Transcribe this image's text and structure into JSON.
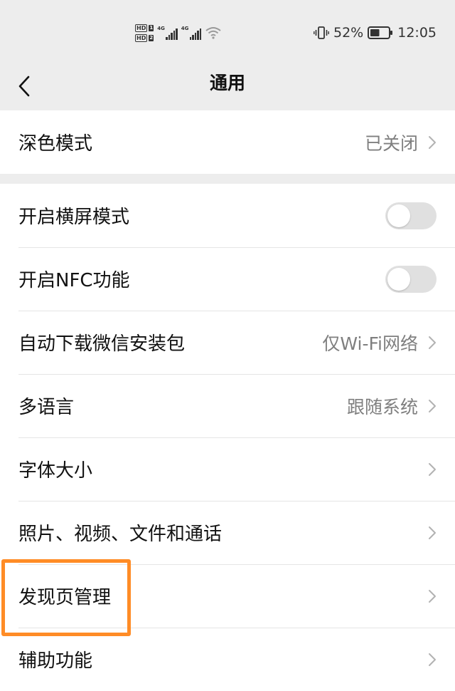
{
  "status_bar": {
    "sim1_tag": "HD",
    "sim1_num": "1",
    "sim2_tag": "HD",
    "sim2_num": "2",
    "net1": "4G",
    "net2": "4G",
    "battery_percent": "52%",
    "time": "12:05",
    "battery_level": 0.52
  },
  "nav": {
    "title": "通用"
  },
  "settings": {
    "dark_mode": {
      "label": "深色模式",
      "value": "已关闭"
    },
    "landscape": {
      "label": "开启横屏模式",
      "enabled": false
    },
    "nfc": {
      "label": "开启NFC功能",
      "enabled": false
    },
    "auto_download": {
      "label": "自动下载微信安装包",
      "value": "仅Wi-Fi网络"
    },
    "language": {
      "label": "多语言",
      "value": "跟随系统"
    },
    "font_size": {
      "label": "字体大小"
    },
    "media": {
      "label": "照片、视频、文件和通话"
    },
    "discover": {
      "label": "发现页管理"
    },
    "accessibility": {
      "label": "辅助功能"
    }
  },
  "colors": {
    "background": "#ededed",
    "card": "#ffffff",
    "highlight": "#ff8c26",
    "toggle_off": "#e0e0e0",
    "value_text": "#7f7f7f"
  }
}
